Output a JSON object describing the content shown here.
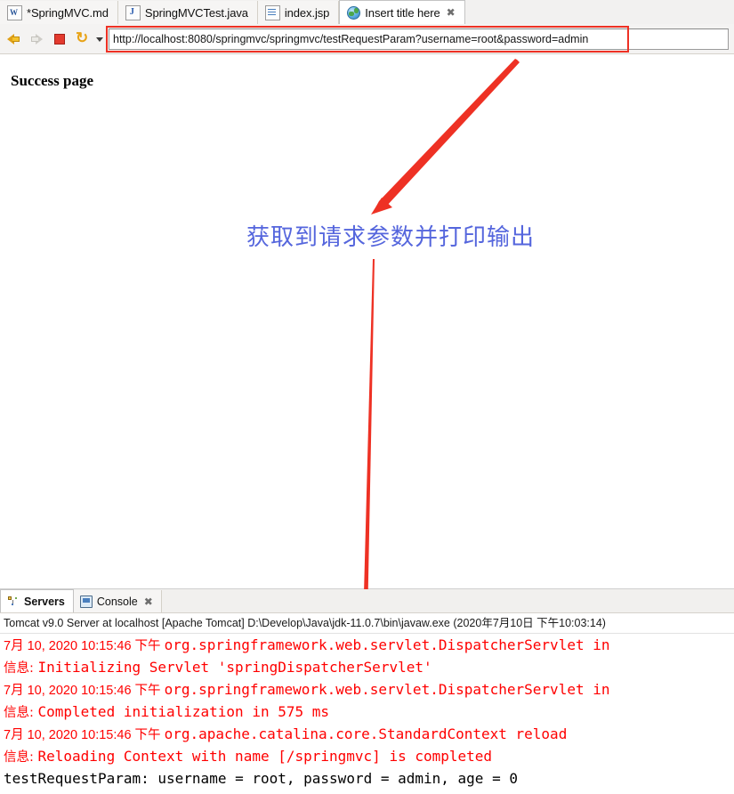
{
  "editor_tabs": [
    {
      "label": "*SpringMVC.md",
      "icon": "word-file-icon",
      "active": false,
      "closable": false
    },
    {
      "label": "SpringMVCTest.java",
      "icon": "java-file-icon",
      "active": false,
      "closable": false
    },
    {
      "label": "index.jsp",
      "icon": "jsp-file-icon",
      "active": false,
      "closable": false
    },
    {
      "label": "Insert title here",
      "icon": "globe-icon",
      "active": true,
      "closable": true,
      "close_glyph": "✖"
    }
  ],
  "toolbar": {
    "back_icon": "back-arrow-icon",
    "forward_icon": "forward-arrow-icon",
    "stop_icon": "stop-icon",
    "refresh_icon": "refresh-icon",
    "dropdown_icon": "chevron-down-icon",
    "url_value": "http://localhost:8080/springmvc/springmvc/testRequestParam?username=root&password=admin",
    "url_placeholder": "Enter URL"
  },
  "page": {
    "heading": "Success page",
    "annotation": "获取到请求参数并打印输出"
  },
  "annotations": {
    "url_highlight_color": "#ee3124",
    "arrow_color": "#ee3124",
    "annotation_text_color": "#5566dd"
  },
  "bottom_view": {
    "tabs": [
      {
        "label": "Servers",
        "icon": "servers-icon",
        "active": true,
        "closable": false
      },
      {
        "label": "Console",
        "icon": "console-icon",
        "active": false,
        "closable": true,
        "close_glyph": "✖"
      }
    ],
    "status_line": "Tomcat v9.0 Server at localhost [Apache Tomcat] D:\\Develop\\Java\\jdk-11.0.7\\bin\\javaw.exe  (2020年7月10日 下午10:03:14)",
    "log_lines": [
      {
        "color": "#ff0000",
        "timestamp": "7月 10, 2020 10:15:46 下午 ",
        "body": "org.springframework.web.servlet.DispatcherServlet in"
      },
      {
        "color": "#ff0000",
        "level": "信息: ",
        "body": "Initializing Servlet 'springDispatcherServlet'"
      },
      {
        "color": "#ff0000",
        "timestamp": "7月 10, 2020 10:15:46 下午 ",
        "body": "org.springframework.web.servlet.DispatcherServlet in"
      },
      {
        "color": "#ff0000",
        "level": "信息: ",
        "body": "Completed initialization in 575 ms"
      },
      {
        "color": "#ff0000",
        "timestamp": "7月 10, 2020 10:15:46 下午 ",
        "body": "org.apache.catalina.core.StandardContext reload"
      },
      {
        "color": "#ff0000",
        "level": "信息: ",
        "body": "Reloading Context with name [/springmvc] is completed"
      },
      {
        "color": "#000000",
        "body": "testRequestParam: username = root, password = admin, age = 0"
      }
    ]
  }
}
